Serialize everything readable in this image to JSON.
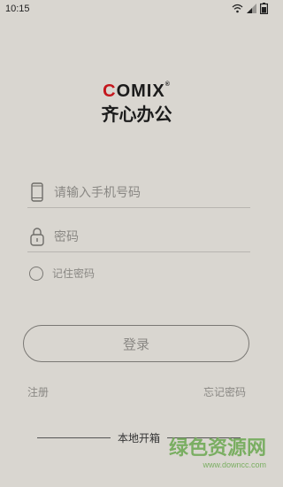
{
  "status": {
    "time": "10:15"
  },
  "logo": {
    "brand_first": "C",
    "brand_rest": "OMIX",
    "registered": "®",
    "chinese_name": "齐心办公"
  },
  "form": {
    "phone_placeholder": "请输入手机号码",
    "password_placeholder": "密码",
    "remember_label": "记住密码",
    "login_label": "登录"
  },
  "links": {
    "register": "注册",
    "forgot": "忘记密码"
  },
  "footer": {
    "local_box": "本地开箱"
  },
  "watermark": {
    "title": "绿色资源网",
    "url": "www.downcc.com"
  },
  "colors": {
    "brand_red": "#c4161c",
    "background": "#d9d6d0",
    "watermark_green": "#6aa84f"
  }
}
